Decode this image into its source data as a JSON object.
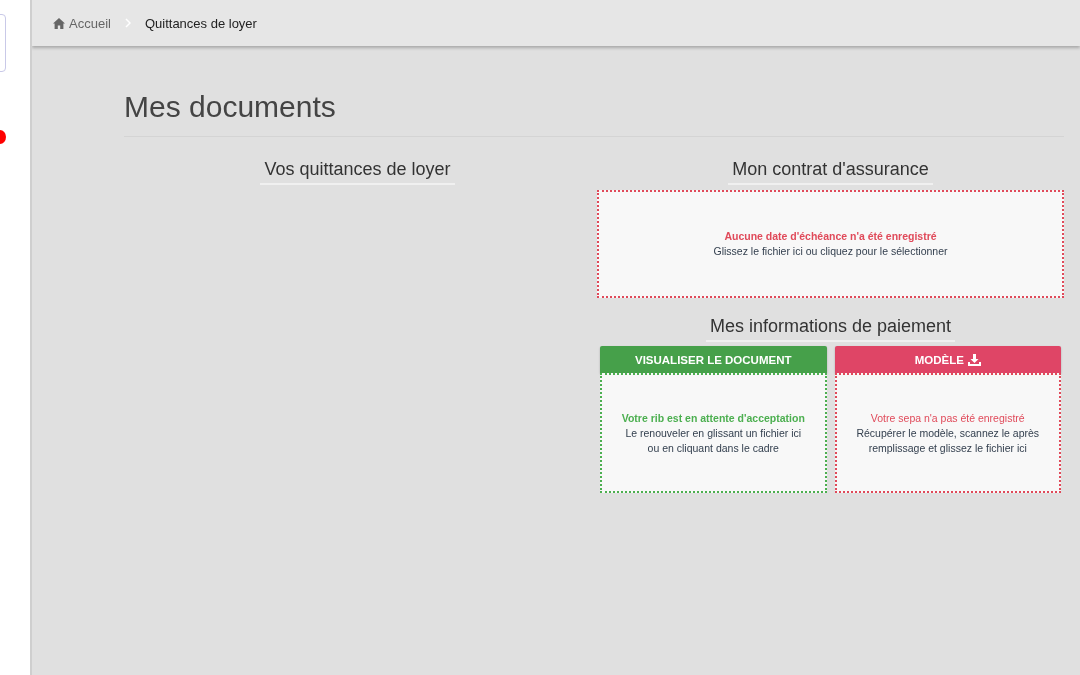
{
  "breadcrumb": [
    {
      "label": "Accueil",
      "kind": "home"
    },
    {
      "label": "Quittances de loyer",
      "kind": "current"
    }
  ],
  "page_title": "Mes documents",
  "receipts": {
    "title": "Vos quittances de loyer"
  },
  "insurance": {
    "title": "Mon contrat d'assurance",
    "dropzone": {
      "kind": "missing",
      "message": "Aucune date d'échéance n'a été enregistré",
      "hint": "Glissez le fichier ici ou cliquez pour le sélectionner",
      "bold": true
    }
  },
  "payment": {
    "title": "Mes informations de paiement",
    "cards": [
      {
        "button": {
          "label": "VISUALISER LE DOCUMENT",
          "kind": "view"
        },
        "kind": "ok",
        "message": "Votre rib est en attente d'acceptation",
        "hint": "Le renouveler en glissant un fichier ici ou en cliquant dans le cadre",
        "bold": true
      },
      {
        "button": {
          "label": "MODÈLE",
          "kind": "template"
        },
        "kind": "missing",
        "message": "Votre sepa n'a pas été enregistré",
        "hint": "Récupérer le modèle, scannez le après remplissage et glissez le fichier ici",
        "bold": false
      }
    ]
  }
}
